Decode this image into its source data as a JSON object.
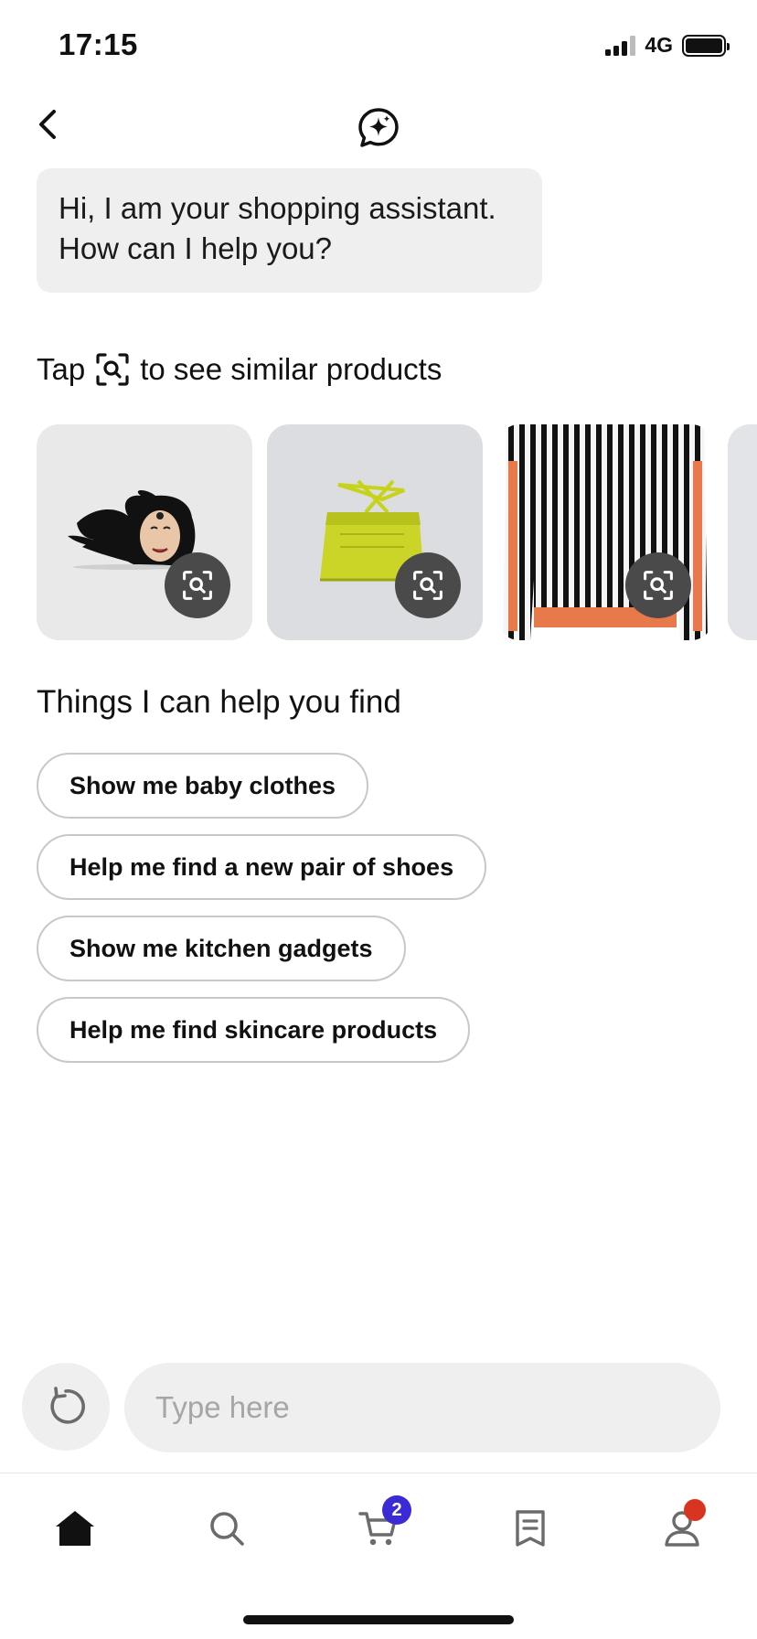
{
  "status_bar": {
    "time": "17:15",
    "network": "4G",
    "battery_level": 1.0
  },
  "header": {
    "back_icon": "chevron-left-icon",
    "logo_icon": "assistant-sparkle-icon"
  },
  "assistant_message": {
    "text": "Hi, I am your shopping assistant. How can I help you?"
  },
  "tap_hint": {
    "before": "Tap",
    "icon": "visual-search-icon",
    "after": "to see similar products"
  },
  "products": [
    {
      "name": "face-pin",
      "icon": "visual-search-icon"
    },
    {
      "name": "lime-skirt",
      "icon": "visual-search-icon"
    },
    {
      "name": "striped-sweater",
      "icon": "visual-search-icon"
    },
    {
      "name": "partial-product"
    }
  ],
  "suggestions": {
    "title": "Things I can help you find",
    "items": [
      "Show me baby clothes",
      "Help me find a new pair of shoes",
      "Show me kitchen gadgets",
      "Help me find skincare products"
    ]
  },
  "input": {
    "placeholder": "Type here",
    "refresh_icon": "refresh-icon"
  },
  "tab_bar": {
    "items": [
      {
        "icon": "home-icon",
        "active": true
      },
      {
        "icon": "search-icon"
      },
      {
        "icon": "cart-icon",
        "badge": "2"
      },
      {
        "icon": "orders-icon"
      },
      {
        "icon": "profile-icon",
        "dot": true
      }
    ]
  },
  "colors": {
    "bubble_bg": "#efefef",
    "cart_badge": "#3b2bd6",
    "profile_dot": "#d9341f",
    "scan_button": "#4a4a4a"
  }
}
